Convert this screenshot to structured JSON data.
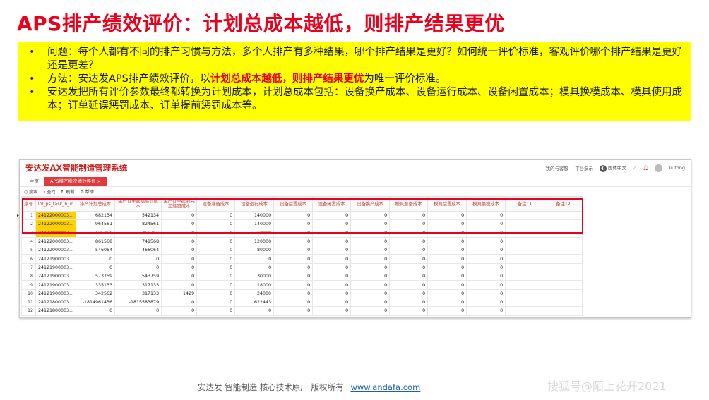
{
  "slide": {
    "title": "APS排产绩效评价：计划总成本越低，则排产结果更优",
    "bullets": {
      "b1": "问题：每个人都有不同的排产习惯与方法，多个人排产有多种结果，哪个排产结果是更好？如何统一评价标准，客观评价哪个排产结果是更好还是更差？",
      "b2_pre": "方法：安达发APS排产绩效评价，以",
      "b2_hl": "计划总成本越低，则排产结果更优",
      "b2_post": "为唯一评价标准。",
      "b3": "安达发把所有评价参数最终都转换为计划成本，计划总成本包括：设备换产成本、设备运行成本、设备闲置成本；模具换模成本、模具使用成本；订单延误惩罚成本、订单提前惩罚成本等。"
    }
  },
  "app": {
    "title": "安达发AX智能制造管理系统",
    "header_links": [
      "我的与客服",
      "平台演示",
      "国体中文",
      "liutong"
    ],
    "tabs": [
      "主页",
      "APS排产批次绩效评价 ×"
    ],
    "toolbar": [
      "搜索",
      "查找",
      "刷新",
      "帮助"
    ],
    "columns": [
      "序号",
      "lbl_ps_task_h_id",
      "排产计划总成本",
      "生产订单延误惩罚成本",
      "生产订单提前完工惩罚成本",
      "设备准备成本",
      "设备运行成本",
      "设备后置成本",
      "设备闲置成本",
      "设备换产成本",
      "模具准备成本",
      "模具后置成本",
      "模具换模成本",
      "备注11",
      "备注12"
    ],
    "rows": [
      [
        "1",
        "24122000003...",
        "682134",
        "542134",
        "0",
        "0",
        "140000",
        "0",
        "0",
        "0",
        "0",
        "0",
        "0",
        "",
        ""
      ],
      [
        "2",
        "24122000003...",
        "964561",
        "824561",
        "0",
        "0",
        "140000",
        "0",
        "0",
        "0",
        "0",
        "0",
        "0",
        "",
        ""
      ],
      [
        "3",
        "24122000003...",
        "425356",
        "365356",
        "0",
        "0",
        "60000",
        "0",
        "0",
        "0",
        "0",
        "0",
        "0",
        "",
        ""
      ],
      [
        "4",
        "24122000003...",
        "861568",
        "741568",
        "0",
        "0",
        "120000",
        "0",
        "0",
        "0",
        "0",
        "0",
        "0",
        "",
        ""
      ],
      [
        "5",
        "24122000003...",
        "546064",
        "466064",
        "0",
        "0",
        "80000",
        "0",
        "0",
        "0",
        "0",
        "0",
        "0",
        "",
        ""
      ],
      [
        "6",
        "24121900003...",
        "0",
        "0",
        "0",
        "0",
        "0",
        "0",
        "0",
        "0",
        "0",
        "0",
        "0",
        "",
        ""
      ],
      [
        "7",
        "24121900003...",
        "0",
        "0",
        "0",
        "0",
        "0",
        "0",
        "0",
        "0",
        "0",
        "0",
        "0",
        "",
        ""
      ],
      [
        "8",
        "24121900003...",
        "573759",
        "543759",
        "0",
        "0",
        "30000",
        "0",
        "0",
        "0",
        "0",
        "0",
        "0",
        "",
        ""
      ],
      [
        "9",
        "24121900003...",
        "335133",
        "317133",
        "0",
        "0",
        "18000",
        "0",
        "0",
        "0",
        "0",
        "0",
        "0",
        "",
        ""
      ],
      [
        "10",
        "24121900003...",
        "342562",
        "317133",
        "1429",
        "0",
        "24000",
        "0",
        "0",
        "0",
        "0",
        "0",
        "0",
        "",
        ""
      ],
      [
        "11",
        "24121800003...",
        "-1814961436",
        "-1815583879",
        "0",
        "0",
        "622443",
        "0",
        "0",
        "0",
        "0",
        "0",
        "0",
        "",
        ""
      ],
      [
        "12",
        "24121800003...",
        "0",
        "0",
        "0",
        "0",
        "0",
        "0",
        "0",
        "0",
        "0",
        "0",
        "0",
        "",
        ""
      ]
    ]
  },
  "footer": {
    "text": "安达发   智能制造 核心技术原厂   版权所有",
    "url": "www.andafa.com"
  },
  "watermark": "搜狐号@陌上花开2021",
  "colors": {
    "title": "#e8001c",
    "callout_bg": "#ffff00",
    "highlight_cell": "#ffd000",
    "tab_active": "#e03a3a"
  }
}
